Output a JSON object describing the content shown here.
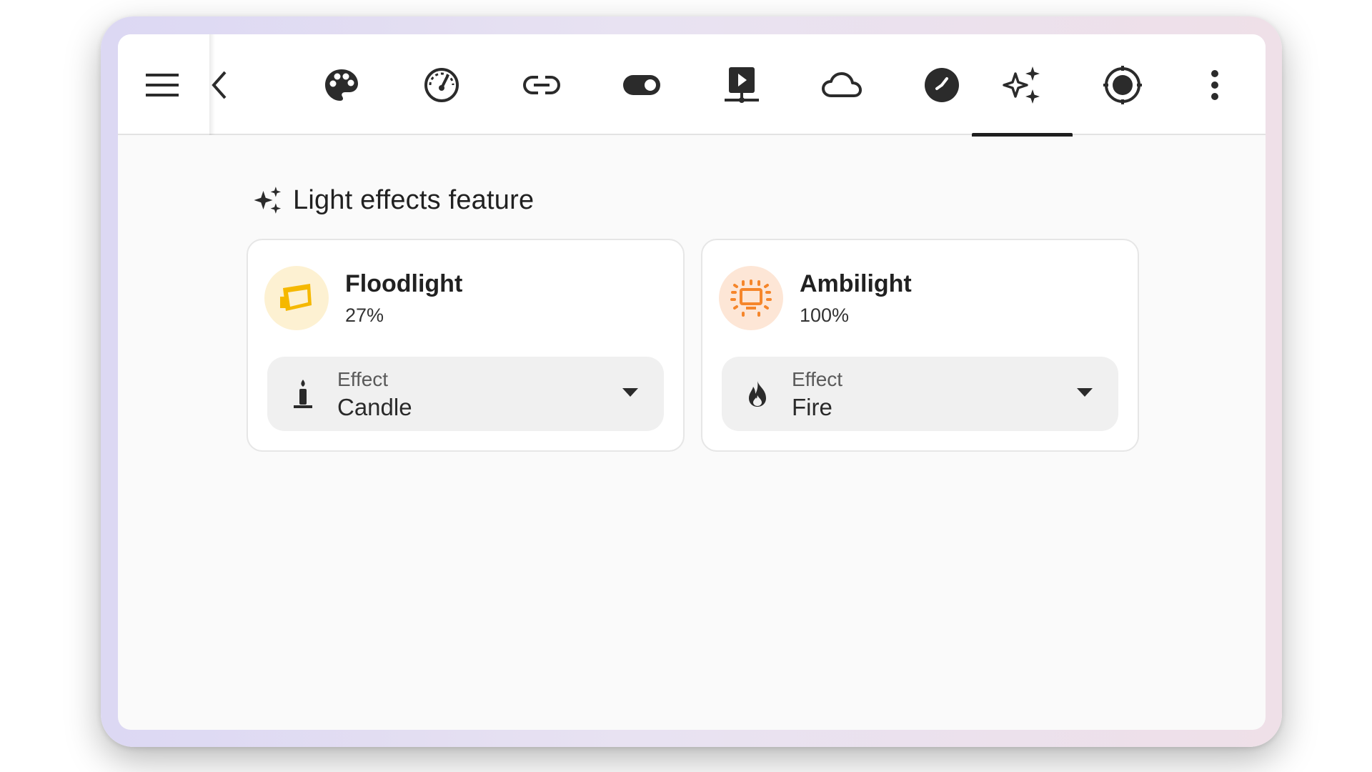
{
  "toolbar": {
    "icons": [
      "menu-icon",
      "chevron-left-icon",
      "palette-icon",
      "speedometer-icon",
      "link-icon",
      "toggle-switch-icon",
      "video-input-icon",
      "cloud-outline-icon",
      "clock-icon",
      "creation-sparkles-icon",
      "target-icon",
      "dots-vertical-icon"
    ],
    "selected_tab": "creation-sparkles-icon"
  },
  "section": {
    "title": "Light effects feature",
    "icon": "creation-sparkles-icon"
  },
  "cards": [
    {
      "name": "Floodlight",
      "state": "27%",
      "icon": "floodlight-icon",
      "icon_color": "#f5b800",
      "icon_bg": "#fdf1d2",
      "select_label": "Effect",
      "select_value": "Candle",
      "select_icon": "candle-icon"
    },
    {
      "name": "Ambilight",
      "state": "100%",
      "icon": "ambilight-icon",
      "icon_color": "#f5862b",
      "icon_bg": "#fde6d6",
      "select_label": "Effect",
      "select_value": "Fire",
      "select_icon": "fire-icon"
    }
  ],
  "colors": {
    "accent": "#1f1f1f",
    "card_border": "#e6e6e6",
    "select_bg": "#f0f0f0"
  }
}
